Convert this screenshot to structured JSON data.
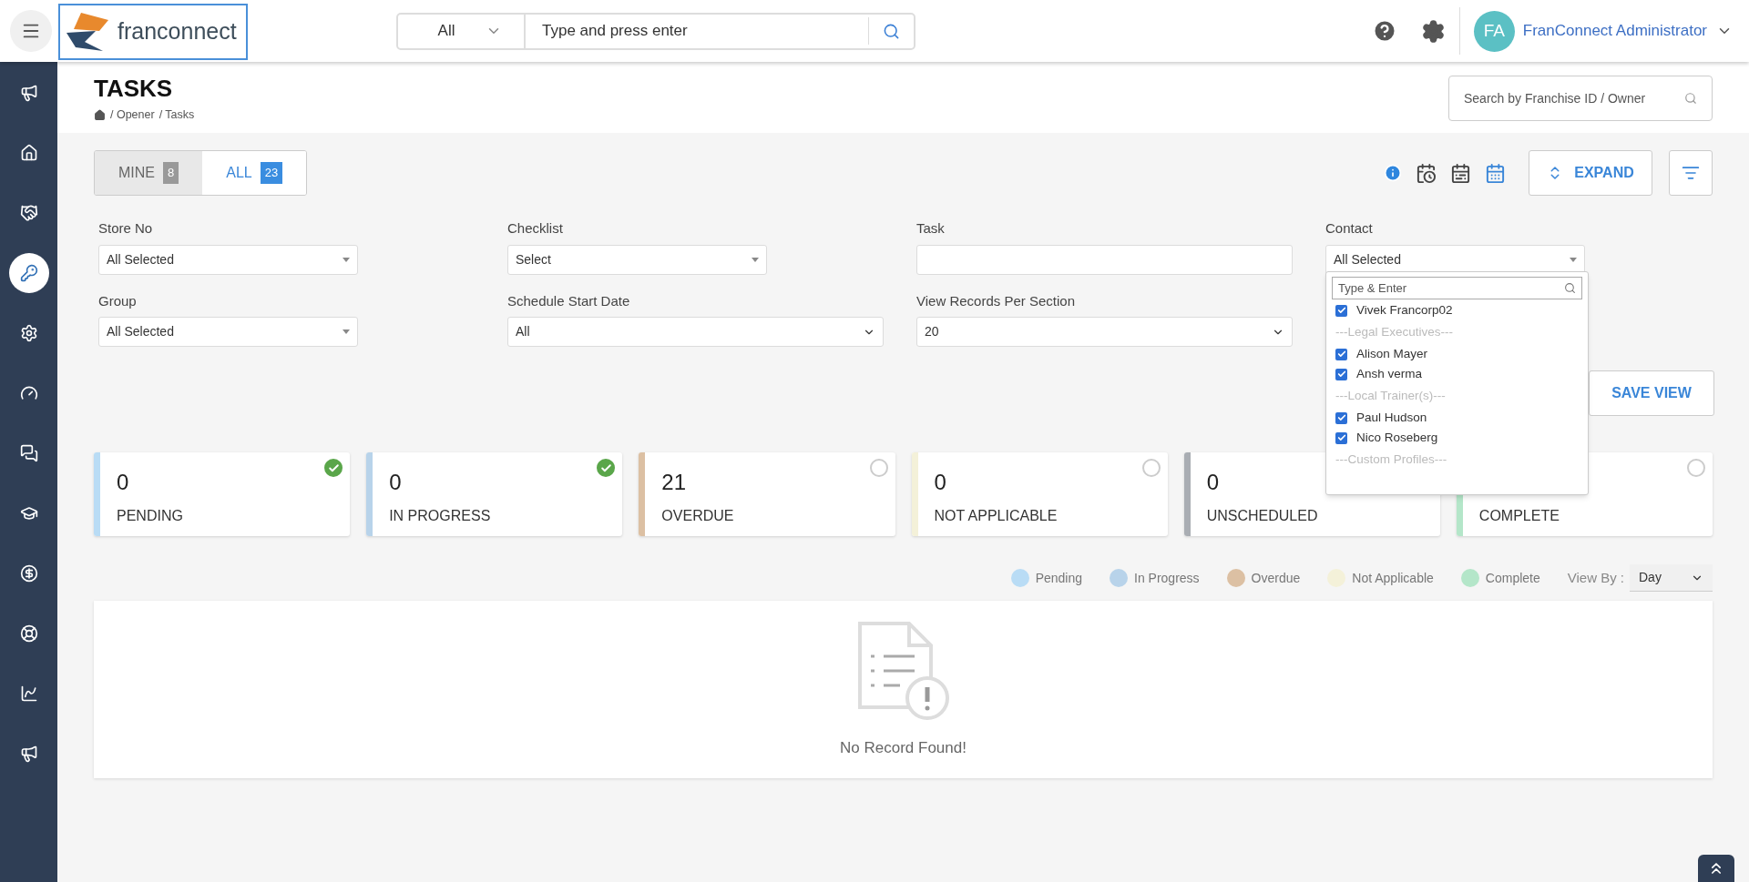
{
  "header": {
    "logo_text": "franconnect",
    "search": {
      "scope": "All",
      "placeholder": "Type and press enter"
    },
    "user": {
      "initials": "FA",
      "name": "FranConnect Administrator"
    }
  },
  "sidebar": {
    "items": [
      {
        "selected": false
      },
      {
        "selected": false
      },
      {
        "selected": false
      },
      {
        "selected": true
      },
      {
        "selected": false
      },
      {
        "selected": false
      },
      {
        "selected": false
      },
      {
        "selected": false
      },
      {
        "selected": false
      },
      {
        "selected": false
      },
      {
        "selected": false
      },
      {
        "selected": false
      }
    ]
  },
  "page": {
    "title": "TASKS",
    "breadcrumbs": [
      "/ Opener",
      "/ Tasks"
    ],
    "franchise_search": {
      "placeholder": "Search by Franchise ID / Owner"
    }
  },
  "tabs": [
    {
      "label": "MINE",
      "count": "8",
      "selected": false
    },
    {
      "label": "ALL",
      "count": "23",
      "selected": true
    }
  ],
  "toolbar": {
    "expand": "EXPAND",
    "save_view": "SAVE VIEW"
  },
  "filters": [
    {
      "label": "Store No",
      "value": "All Selected",
      "kind": "multi"
    },
    {
      "label": "Checklist",
      "value": "Select",
      "kind": "multi"
    },
    {
      "label": "Task",
      "kind": "text"
    },
    {
      "label": "Contact",
      "value": "All Selected",
      "kind": "multi"
    },
    {
      "label": "Group",
      "value": "All Selected",
      "kind": "multi"
    },
    {
      "label": "Schedule Start Date",
      "value": "All",
      "kind": "select"
    },
    {
      "label": "View Records Per Section",
      "value": "20",
      "kind": "select"
    }
  ],
  "contact_dropdown": {
    "placeholder": "Type & Enter",
    "items": [
      {
        "kind": "option",
        "label": "Vivek Francorp02",
        "checked": true
      },
      {
        "kind": "group",
        "label": "---Legal Executives---"
      },
      {
        "kind": "option",
        "label": "Alison Mayer",
        "checked": true
      },
      {
        "kind": "option",
        "label": "Ansh verma",
        "checked": true
      },
      {
        "kind": "group",
        "label": "---Local Trainer(s)---"
      },
      {
        "kind": "option",
        "label": "Paul Hudson",
        "checked": true
      },
      {
        "kind": "option",
        "label": "Nico Roseberg",
        "checked": true
      },
      {
        "kind": "group",
        "label": "---Custom Profiles---"
      }
    ]
  },
  "status_cards": [
    {
      "value": "0",
      "label": "PENDING",
      "color": "#b9dcf5",
      "checked": true
    },
    {
      "value": "0",
      "label": "IN PROGRESS",
      "color": "#b8d3ea",
      "checked": true
    },
    {
      "value": "21",
      "label": "OVERDUE",
      "color": "#dcc0a3",
      "checked": false
    },
    {
      "value": "0",
      "label": "NOT APPLICABLE",
      "color": "#f4f1d9",
      "checked": false
    },
    {
      "value": "0",
      "label": "UNSCHEDULED",
      "color": "#a9adb3"
    },
    {
      "label": "COMPLETE",
      "color": "#b4e6c9",
      "checked": false
    }
  ],
  "legend": [
    {
      "label": "Pending",
      "color": "#b9dcf5"
    },
    {
      "label": "In Progress",
      "color": "#b8d3ea"
    },
    {
      "label": "Overdue",
      "color": "#dcc0a3"
    },
    {
      "label": "Not Applicable",
      "color": "#f4f1d9"
    },
    {
      "label": "Complete",
      "color": "#b4e6c9"
    }
  ],
  "view_by": {
    "label": "View By :",
    "value": "Day"
  },
  "empty_state": {
    "message": "No Record Found!"
  }
}
